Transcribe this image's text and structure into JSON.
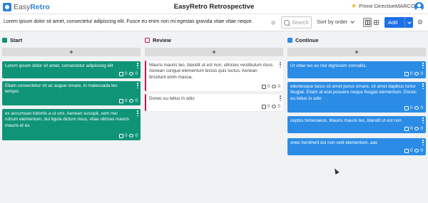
{
  "header": {
    "logo_text_plain": "Easy",
    "logo_text_bold": "Retro",
    "title": "EasyRetro Retrospective",
    "prime_directive": "Prime Directive",
    "username": "MARCO"
  },
  "toolbar": {
    "description": "Lorem ipsum dolor sit amet, consectetur adipiscing elit. Fusce eu enim non mi egestas gravida vitae vitae neque.",
    "search_placeholder": "Search",
    "sort_label": "Sort by order",
    "add_label": "Add"
  },
  "colors": {
    "accent_blue": "#1f6fe5",
    "start_green": "#0f9478",
    "review_red": "#c2185b",
    "continue_blue": "#2b8ce6"
  },
  "add_card_label": "+",
  "columns": [
    {
      "title": "Start",
      "cards": [
        {
          "text": "Lorem ipsum dolor sit amet, consectetur adipiscing elit",
          "likes": "0",
          "comments": "0"
        },
        {
          "text": "Etiam consectetur mi ac augue ornare, in malesuada leo tempor",
          "likes": "0",
          "comments": "0"
        },
        {
          "text": "ex accumsan lobortis a ut orci. Aenean suscipit, sem nec rutrum elementum, dui ligula dictum risus, vitae ultrices mauris mauris et ex.",
          "likes": "0",
          "comments": "0"
        }
      ]
    },
    {
      "title": "Review",
      "cards": [
        {
          "text": "Mauris mauris leo, blandit ut est non, ultricies vestibulum risus. Aenean congue elementum lectus quis luctus. Aenean tincidunt enim massa,",
          "likes": "0",
          "comments": "0"
        },
        {
          "text": "Donec eu tellus in odio",
          "likes": "0",
          "comments": "0"
        }
      ]
    },
    {
      "title": "Continue",
      "cards": [
        {
          "text": "Ut vitae leo eu nisl dignissim convallis.",
          "likes": "0",
          "comments": "0"
        },
        {
          "text": "ellentesque lacus sit amet purus ornare, sit amet dapibus tortor feugiat. Etiam at erat posuere neque feugiat elementum. Donec eu tellus in odio",
          "likes": "0",
          "comments": "0"
        },
        {
          "text": "ceptos himenaeos. Mauris mauris leo, blandit ut est non",
          "likes": "0",
          "comments": "0"
        },
        {
          "text": "onec hendrerit dui non velit elementum, aas",
          "likes": "0",
          "comments": "0"
        }
      ]
    }
  ]
}
